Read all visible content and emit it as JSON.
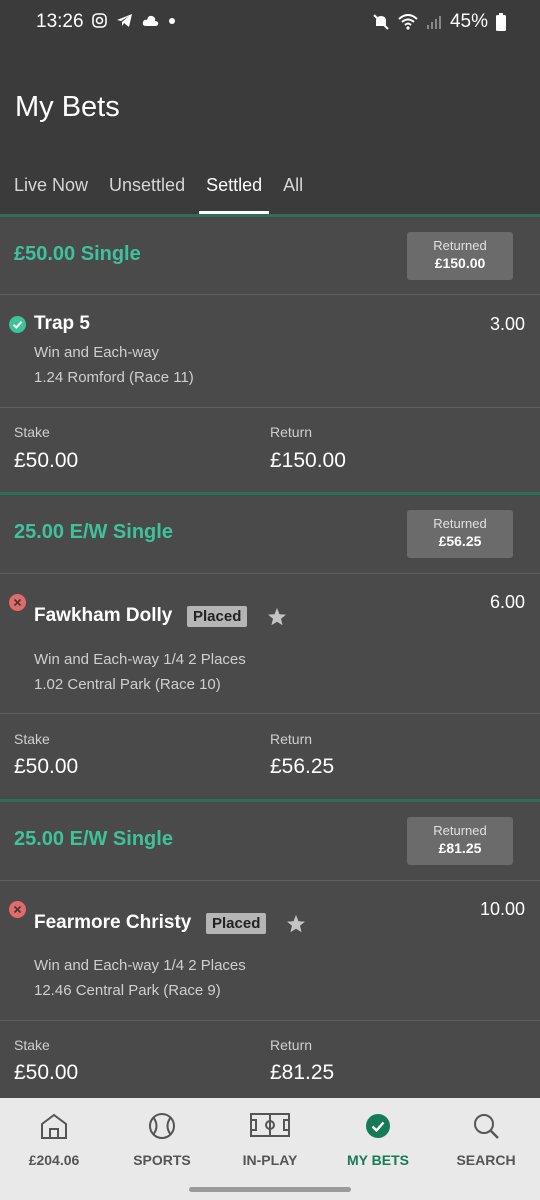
{
  "status_bar": {
    "time": "13:26",
    "battery": "45%"
  },
  "header": {
    "title": "My Bets",
    "tabs": [
      {
        "label": "Live Now"
      },
      {
        "label": "Unsettled"
      },
      {
        "label": "Settled"
      },
      {
        "label": "All"
      }
    ],
    "active_tab": "Settled"
  },
  "bets": [
    {
      "type": "£50.00 Single",
      "returned_label": "Returned",
      "returned_value": "£150.00",
      "selection": "Trap 5",
      "result": "win",
      "placed": "",
      "odds": "3.00",
      "market": "Win and Each-way",
      "event": "1.24 Romford (Race 11)",
      "stake_label": "Stake",
      "stake": "£50.00",
      "return_label": "Return",
      "return": "£150.00"
    },
    {
      "type": "25.00 E/W Single",
      "returned_label": "Returned",
      "returned_value": "£56.25",
      "selection": "Fawkham Dolly",
      "result": "lose",
      "placed": "Placed",
      "odds": "6.00",
      "market": "Win and Each-way 1/4 2 Places",
      "event": "1.02 Central Park (Race 10)",
      "stake_label": "Stake",
      "stake": "£50.00",
      "return_label": "Return",
      "return": "£56.25"
    },
    {
      "type": "25.00 E/W Single",
      "returned_label": "Returned",
      "returned_value": "£81.25",
      "selection": "Fearmore Christy",
      "result": "lose",
      "placed": "Placed",
      "odds": "10.00",
      "market": "Win and Each-way 1/4 2 Places",
      "event": "12.46 Central Park (Race 9)",
      "stake_label": "Stake",
      "stake": "£50.00",
      "return_label": "Return",
      "return": "£81.25"
    }
  ],
  "bottom_nav": [
    {
      "label": "£204.06",
      "icon": "home-icon"
    },
    {
      "label": "SPORTS",
      "icon": "tennis-ball-icon"
    },
    {
      "label": "IN-PLAY",
      "icon": "pitch-icon"
    },
    {
      "label": "MY BETS",
      "icon": "check-circle-icon"
    },
    {
      "label": "SEARCH",
      "icon": "search-icon"
    }
  ],
  "colors": {
    "accent": "#3ec29a",
    "header_bg": "#3b3b3b",
    "body_bg": "#4a4a4a",
    "nav_active": "#167a56"
  }
}
